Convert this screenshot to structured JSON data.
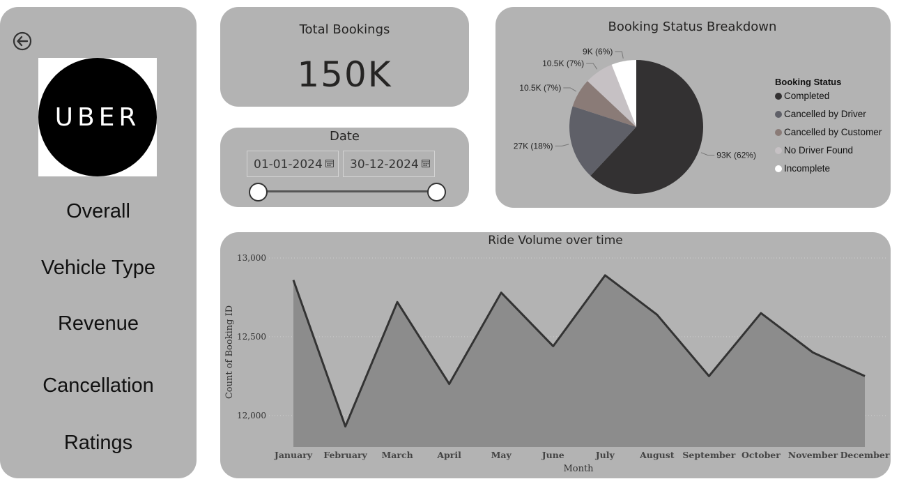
{
  "sidebar": {
    "logo_text": "UBER",
    "nav": [
      "Overall",
      "Vehicle Type",
      "Revenue",
      "Cancellation",
      "Ratings"
    ]
  },
  "kpi": {
    "label": "Total Bookings",
    "value": "150K"
  },
  "date_filter": {
    "label": "Date",
    "start": "01-01-2024",
    "end": "30-12-2024",
    "range_position": [
      0,
      1
    ]
  },
  "status_breakdown": {
    "title": "Booking Status Breakdown",
    "legend_title": "Booking Status",
    "slices": [
      {
        "name": "Completed",
        "value": 93000,
        "label": "93K (62%)",
        "color": "#333132"
      },
      {
        "name": "Cancelled by Driver",
        "value": 27000,
        "label": "27K (18%)",
        "color": "#5f6068"
      },
      {
        "name": "Cancelled by Customer",
        "value": 10500,
        "label": "10.5K (7%)",
        "color": "#8a7b77"
      },
      {
        "name": "No Driver Found",
        "value": 10500,
        "label": "10.5K (7%)",
        "color": "#c6c1c4"
      },
      {
        "name": "Incomplete",
        "value": 9000,
        "label": "9K (6%)",
        "color": "#ffffff"
      }
    ]
  },
  "ride_volume": {
    "title": "Ride Volume over time",
    "xlabel": "Month",
    "ylabel": "Count of Booking ID",
    "yticks": [
      "13,000",
      "12,500",
      "12,000"
    ]
  },
  "chart_data": {
    "type": "area",
    "title": "Ride Volume over time",
    "xlabel": "Month",
    "ylabel": "Count of Booking ID",
    "categories": [
      "January",
      "February",
      "March",
      "April",
      "May",
      "June",
      "July",
      "August",
      "September",
      "October",
      "November",
      "December"
    ],
    "values": [
      12860,
      11930,
      12720,
      12200,
      12780,
      12440,
      12890,
      12640,
      12250,
      12650,
      12400,
      12250
    ],
    "ylim": [
      11800,
      13000
    ],
    "yticks": [
      12000,
      12500,
      13000
    ],
    "grid": true,
    "fill_color": "#8c8c8c",
    "line_color": "#333333"
  }
}
